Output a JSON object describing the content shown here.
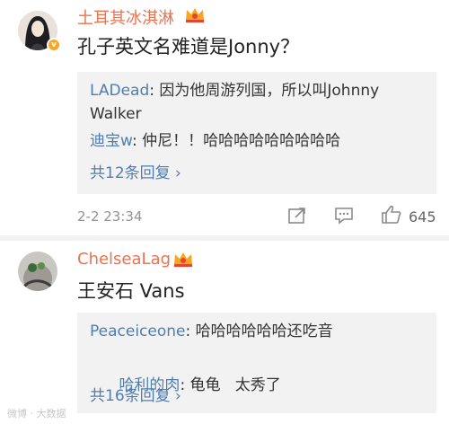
{
  "comments": [
    {
      "username": "土耳其冰淇淋",
      "text": "孔子英文名难道是Jonny？",
      "replies": [
        {
          "name": "LADead",
          "sep": ": ",
          "text": "因为他周游列国，所以叫Johnny Walker"
        },
        {
          "name": "迪宝w",
          "sep": ": ",
          "text": "仲尼！！哈哈哈哈哈哈哈哈哈"
        }
      ],
      "more_replies": "共12条回复 ›",
      "time": "2-2 23:34",
      "likes": "645"
    },
    {
      "username": "ChelseaLag",
      "text": "王安石 Vans",
      "replies": [
        {
          "name": "Peaceiceone",
          "sep": ": ",
          "text": "哈哈哈哈哈哈还吃音"
        },
        {
          "name": "哈利的肉",
          "sep": ": ",
          "text": "龟龟   太秀了"
        }
      ],
      "more_replies": "共16条回复 ›"
    }
  ],
  "watermark": "微博 · 大数据",
  "colors": {
    "username": "#eb7350",
    "reply_name": "#507daf",
    "reply_bg": "#f2f2f2",
    "meta": "#939393",
    "badge": "#f6a623"
  }
}
